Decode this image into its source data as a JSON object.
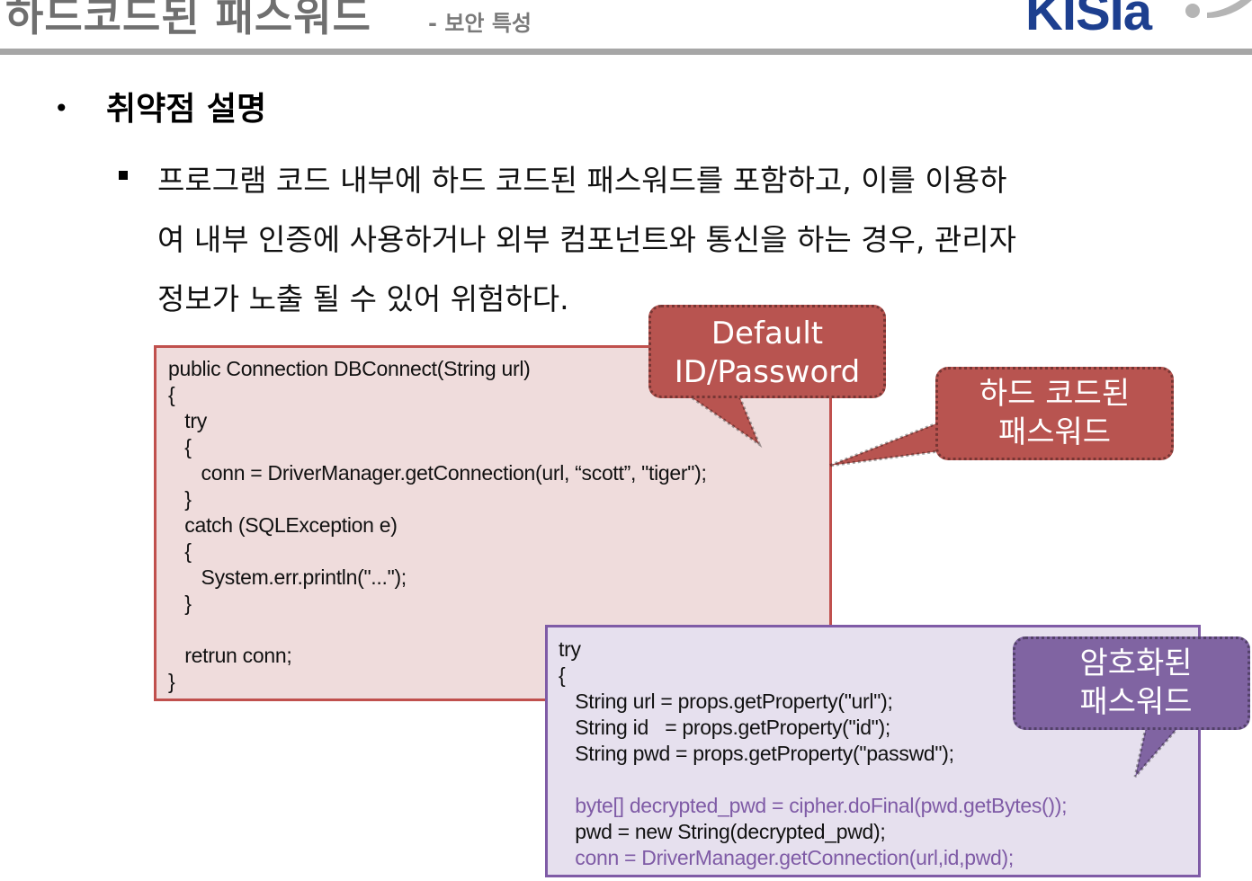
{
  "header": {
    "title": "하드코드된 패스워드",
    "subtitle": "- 보안 특성",
    "logo_text": "KISIa"
  },
  "section": {
    "bullet_title": "취약점 설명",
    "description_lines": [
      "프로그램 코드 내부에 하드 코드된 패스워드를 포함하고, 이를 이용하",
      "여 내부 인증에 사용하거나 외부 컴포넌트와 통신을 하는 경우, 관리자",
      "정보가 노출 될 수 있어 위험하다."
    ]
  },
  "code_unsafe": {
    "lines": [
      "public Connection DBConnect(String url)",
      "{",
      "   try",
      "   {",
      "      conn = DriverManager.getConnection(url, “scott”, \"tiger\");",
      "   }",
      "   catch (SQLException e)",
      "   {",
      "      System.err.println(\"...\");",
      "   }",
      "",
      "   retrun conn;",
      "}"
    ]
  },
  "code_safe": {
    "lines": [
      "try",
      "{",
      "   String url = props.getProperty(\"url\");",
      "   String id   = props.getProperty(\"id\");",
      "   String pwd = props.getProperty(\"passwd\");",
      "",
      "   byte[] decrypted_pwd = cipher.doFinal(pwd.getBytes());",
      "   pwd = new String(decrypted_pwd);",
      "   conn = DriverManager.getConnection(url,id,pwd);"
    ]
  },
  "callouts": {
    "default_credentials": [
      "Default",
      "ID/Password"
    ],
    "hardcoded_password": [
      "하드 코드된",
      "패스워드"
    ],
    "encrypted_password": [
      "암호화된",
      "패스워드"
    ]
  },
  "colors": {
    "unsafe_border": "#c0504d",
    "unsafe_fill": "#efdcdc",
    "safe_border": "#7f5ba6",
    "safe_fill": "#e6e0ee",
    "callout_red": "#b85450",
    "callout_purple": "#8064a2"
  },
  "icons": {
    "list_bullet": "bullet-dot-icon",
    "sub_bullet": "square-bullet-icon"
  }
}
